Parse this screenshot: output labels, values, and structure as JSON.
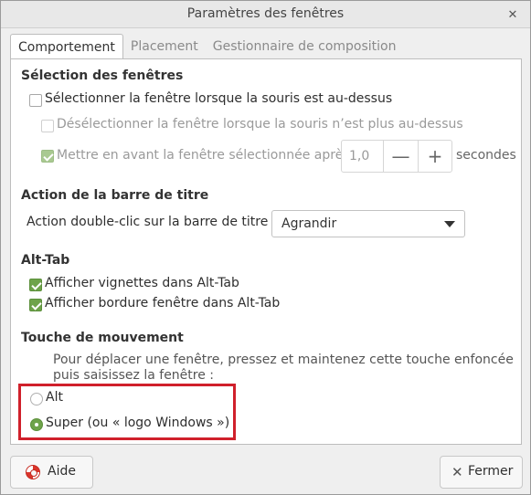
{
  "window": {
    "title": "Paramètres des fenêtres",
    "close_glyph": "✕"
  },
  "tabs": [
    {
      "label": "Comportement",
      "active": true
    },
    {
      "label": "Placement",
      "active": false
    },
    {
      "label": "Gestionnaire de composition",
      "active": false
    }
  ],
  "selection": {
    "heading": "Sélection des fenêtres",
    "focus_follows_mouse": {
      "label": "Sélectionner la fenêtre lorsque la souris est au-dessus",
      "checked": false
    },
    "unfocus_on_leave": {
      "label": "Désélectionner la fenêtre lorsque la souris n’est plus au-dessus",
      "checked": false,
      "disabled": true
    },
    "raise_after": {
      "label": "Mettre en avant la fenêtre sélectionnée après",
      "checked": true,
      "disabled": true
    },
    "delay": {
      "value": "1,0",
      "minus": "—",
      "plus": "+",
      "unit": "secondes"
    }
  },
  "titlebar_action": {
    "heading": "Action de la barre de titre",
    "label": "Action  double-clic sur la barre de titre :",
    "selected": "Agrandir"
  },
  "alttab": {
    "heading": "Alt-Tab",
    "thumbnails": {
      "label": "Afficher vignettes dans Alt-Tab",
      "checked": true
    },
    "border": {
      "label": "Afficher bordure fenêtre dans Alt-Tab",
      "checked": true
    }
  },
  "move_key": {
    "heading": "Touche de mouvement",
    "description_line1": "Pour déplacer une fenêtre, pressez et maintenez cette touche enfoncée",
    "description_line2": "puis saisissez la fenêtre :",
    "options": [
      {
        "label": "Alt",
        "selected": false
      },
      {
        "label": "Super (ou « logo Windows »)",
        "selected": true
      }
    ],
    "highlight_color": "#d0202b"
  },
  "footer": {
    "help_label": "Aide",
    "help_icon": "lifebuoy-icon",
    "close_label": "Fermer",
    "close_icon": "close-icon"
  },
  "accent_color": "#6ea34a"
}
